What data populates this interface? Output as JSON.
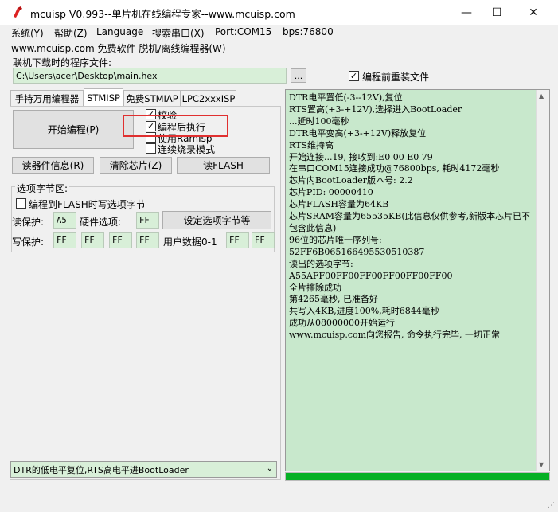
{
  "window": {
    "title": "mcuisp V0.993--单片机在线编程专家--www.mcuisp.com",
    "minimize_glyph": "—",
    "maximize_glyph": "☐",
    "close_glyph": "✕"
  },
  "menu": [
    "系统(Y)",
    "帮助(Z)",
    "Language",
    "搜索串口(X)",
    "Port:COM15",
    "bps:76800"
  ],
  "subtitle": "www.mcuisp.com 免费软件 脱机/离线编程器(W)",
  "file": {
    "label": "联机下载时的程序文件:",
    "path": "C:\\Users\\acer\\Desktop\\main.hex",
    "browse_label": "...",
    "reload_label": "编程前重装文件",
    "reload_checked": true
  },
  "tabs": [
    "手持万用编程器",
    "STMISP",
    "免费STMIAP",
    "LPC2xxxISP"
  ],
  "active_tab": 1,
  "start_button": "开始编程(P)",
  "options": [
    {
      "label": "校验",
      "checked": true
    },
    {
      "label": "编程后执行",
      "checked": true
    },
    {
      "label": "使用RamIsp",
      "checked": false
    },
    {
      "label": "连续烧录模式",
      "checked": false
    }
  ],
  "actions": {
    "read_info": "读器件信息(R)",
    "erase_chip": "清除芯片(Z)",
    "read_flash": "读FLASH"
  },
  "option_bytes": {
    "group_label": "选项字节区:",
    "program_label": "编程到FLASH时写选项字节",
    "program_checked": false,
    "read_protect_label": "读保护:",
    "read_protect_value": "A5",
    "hw_option_label": "硬件选项:",
    "hw_option_value": "FF",
    "set_button": "设定选项字节等",
    "write_protect_label": "写保护:",
    "write_protect_values": [
      "FF",
      "FF",
      "FF",
      "FF"
    ],
    "user_data_label": "用户数据0-1",
    "user_data_values": [
      "FF",
      "FF"
    ]
  },
  "log": [
    "DTR电平置低(-3--12V),复位",
    "RTS置高(+3-+12V),选择进入BootLoader",
    "...延时100毫秒",
    "DTR电平变高(+3-+12V)释放复位",
    "RTS维持高",
    "开始连接...19, 接收到:E0 00 E0 79",
    "在串口COM15连接成功@76800bps, 耗时4172毫秒",
    "芯片内BootLoader版本号: 2.2",
    "芯片PID: 00000410",
    "芯片FLASH容量为64KB",
    "芯片SRAM容量为65535KB(此信息仅供参考,新版本芯片已不包含此信息)",
    "96位的芯片唯一序列号:",
    "52FF6B065166495530510387",
    "读出的选项字节:",
    "A55AFF00FF00FF00FF00FF00FF00",
    "全片擦除成功",
    "第4265毫秒, 已准备好",
    "共写入4KB,进度100%,耗时6844毫秒",
    "成功从08000000开始运行",
    "www.mcuisp.com向您报告, 命令执行完毕, 一切正常"
  ],
  "progress_percent": 100,
  "reset_mode": "DTR的低电平复位,RTS高电平进BootLoader",
  "colors": {
    "field_bg": "#d8efd8",
    "log_bg": "#c8e8cc",
    "progress": "#06b025",
    "highlight": "#e03030"
  }
}
